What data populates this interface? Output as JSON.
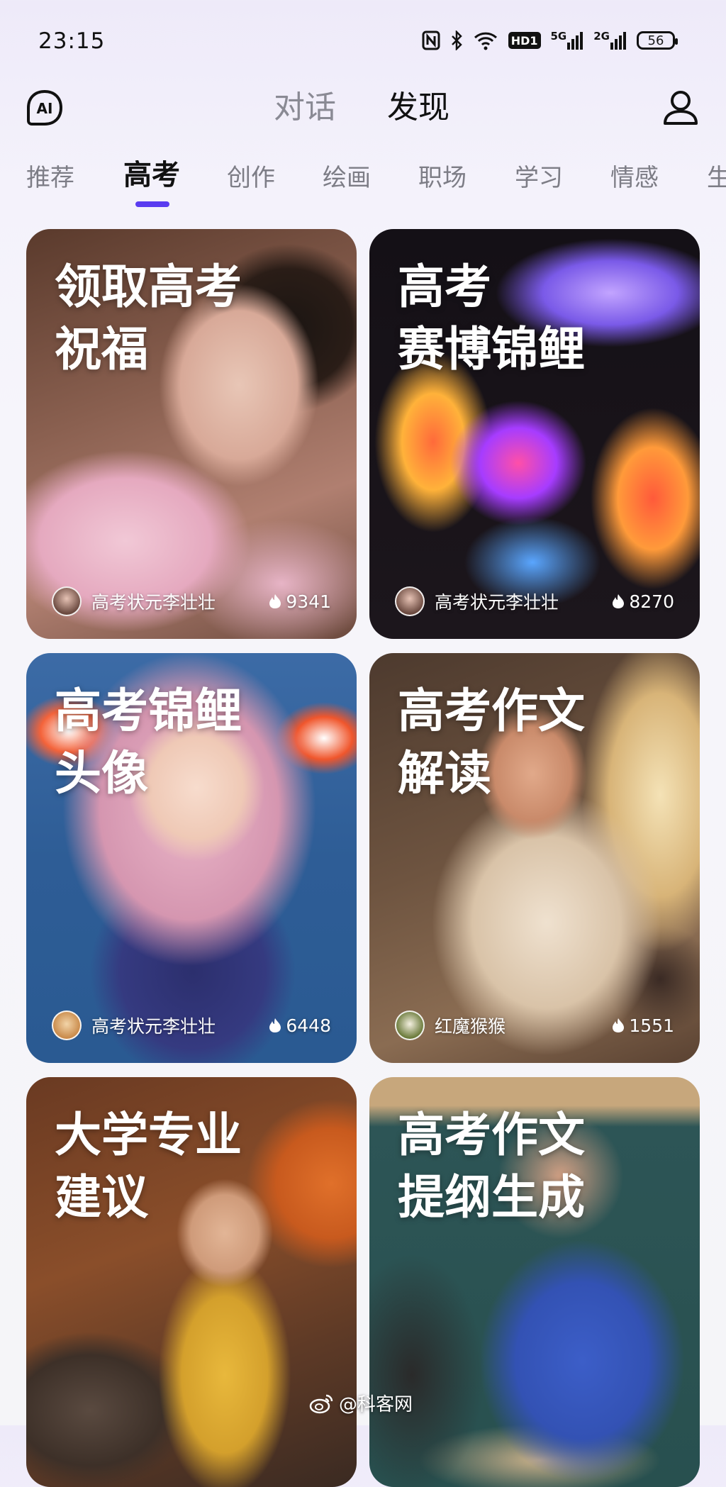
{
  "status_bar": {
    "time": "23:15",
    "icons": [
      "nfc-icon",
      "bluetooth-icon",
      "wifi-icon",
      "hd-icon",
      "signal-5g-icon",
      "signal-2g-icon"
    ],
    "hd_label": "HD1",
    "sig1_label": "5G",
    "sig2_label": "2G",
    "battery": "56"
  },
  "header": {
    "logo_text": "AI",
    "tabs": [
      {
        "label": "对话",
        "active": false
      },
      {
        "label": "发现",
        "active": true
      }
    ],
    "accent_color": "#5a3cf0"
  },
  "categories": [
    {
      "label": "推荐",
      "active": false
    },
    {
      "label": "高考",
      "active": true
    },
    {
      "label": "创作",
      "active": false
    },
    {
      "label": "绘画",
      "active": false
    },
    {
      "label": "职场",
      "active": false
    },
    {
      "label": "学习",
      "active": false
    },
    {
      "label": "情感",
      "active": false
    },
    {
      "label": "生",
      "active": false
    }
  ],
  "cards": [
    {
      "title": "领取高考\n祝福",
      "author": "高考状元李壮壮",
      "likes": "9341"
    },
    {
      "title": "高考\n赛博锦鲤",
      "author": "高考状元李壮壮",
      "likes": "8270"
    },
    {
      "title": "高考锦鲤\n头像",
      "author": "高考状元李壮壮",
      "likes": "6448"
    },
    {
      "title": "高考作文\n解读",
      "author": "红魔猴猴",
      "likes": "1551"
    },
    {
      "title": "大学专业\n建议",
      "author": "",
      "likes": ""
    },
    {
      "title": "高考作文\n提纲生成",
      "author": "",
      "likes": ""
    }
  ],
  "watermark": "@科客网"
}
